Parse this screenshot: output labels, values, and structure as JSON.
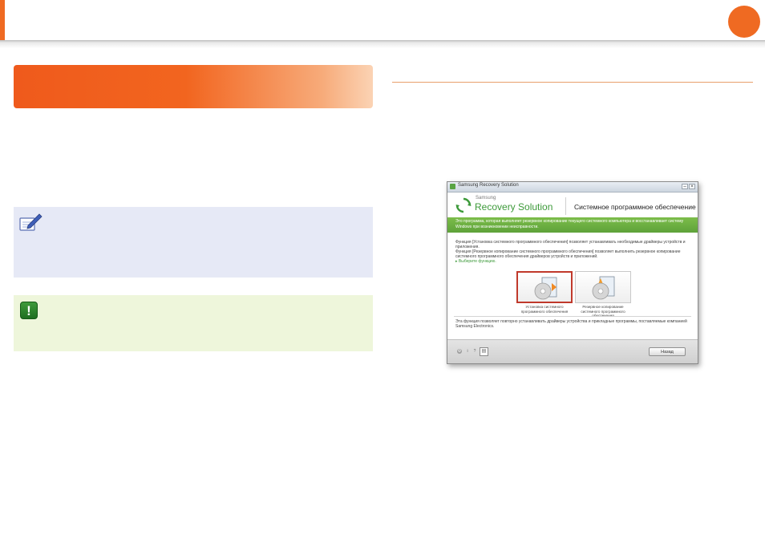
{
  "app_window": {
    "title": "Samsung Recovery Solution",
    "brand_small": "Samsung",
    "brand_large": "Recovery Solution",
    "heading": "Системное программное обеспечение",
    "banner": "Это программа, которая выполняет резервное копирование текущего системного компьютера и восстанавливает систему Windows при возникновении неисправности.",
    "body_lines": [
      "Функция [Установка системного программного обеспечения] позволяет устанавливать необходимые драйверы устройств и приложения.",
      "Функция [Резервное копирование системного программного обеспечения] позволяет выполнить резервное копирование системного программного обеспечения драйверов устройств и приложений."
    ],
    "select_prompt": "Выберите функцию.",
    "options": [
      {
        "label": "Установка системного программного обеспечения",
        "selected": true
      },
      {
        "label": "Резервное копирование системного программного обеспечения",
        "selected": false
      }
    ],
    "description": "Эта функция позволяет повторно устанавливать драйверы устройства и прикладные программы, поставляемые компанией Samsung Electronics.",
    "back_button": "Назад",
    "icons": [
      "gear-icon",
      "info-icon",
      "help-icon",
      "document-icon"
    ]
  },
  "colors": {
    "accent": "#ef6a22",
    "brand_green": "#3d9a3a",
    "note_bg": "#e6e9f6",
    "warning_bg": "#eef6db"
  }
}
